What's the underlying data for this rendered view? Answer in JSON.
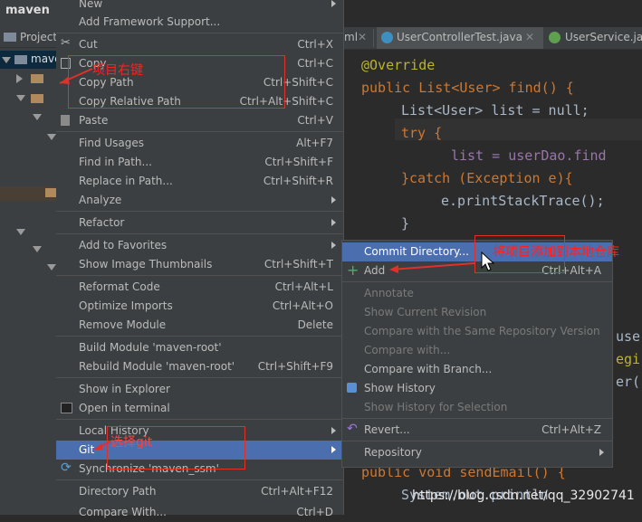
{
  "project_panel": {
    "title": "maven",
    "header_label": "Project",
    "selected_label": "mave"
  },
  "editor": {
    "tabs": [
      {
        "label": "ml",
        "closable": true
      },
      {
        "label": "UserControllerTest.java",
        "closable": true
      },
      {
        "label": "UserService.java",
        "closable": false
      }
    ],
    "code_lines": [
      "@Override",
      "public List<User> find() {",
      "List<User> list = null;",
      "try {",
      "list = userDao.find",
      "}catch (Exception e){",
      "e.printStackTrace();",
      "}",
      "use",
      "egi",
      "er(",
      "public void sendEmail() {",
      "System.out.println"
    ]
  },
  "context_menu": {
    "items": [
      {
        "label": "New",
        "shortcut": "",
        "submenu": true
      },
      {
        "label": "Add Framework Support...",
        "shortcut": ""
      },
      {
        "label": "Cut",
        "shortcut": "Ctrl+X",
        "icon": "scissors-icon"
      },
      {
        "label": "Copy",
        "shortcut": "Ctrl+C",
        "icon": "copy-icon"
      },
      {
        "label": "Copy Path",
        "shortcut": "Ctrl+Shift+C"
      },
      {
        "label": "Copy Relative Path",
        "shortcut": "Ctrl+Alt+Shift+C"
      },
      {
        "label": "Paste",
        "shortcut": "Ctrl+V",
        "icon": "paste-icon"
      },
      {
        "label": "Find Usages",
        "shortcut": "Alt+F7"
      },
      {
        "label": "Find in Path...",
        "shortcut": "Ctrl+Shift+F"
      },
      {
        "label": "Replace in Path...",
        "shortcut": "Ctrl+Shift+R"
      },
      {
        "label": "Analyze",
        "shortcut": "",
        "submenu": true
      },
      {
        "label": "Refactor",
        "shortcut": "",
        "submenu": true
      },
      {
        "label": "Add to Favorites",
        "shortcut": "",
        "submenu": true
      },
      {
        "label": "Show Image Thumbnails",
        "shortcut": "Ctrl+Shift+T"
      },
      {
        "label": "Reformat Code",
        "shortcut": "Ctrl+Alt+L"
      },
      {
        "label": "Optimize Imports",
        "shortcut": "Ctrl+Alt+O"
      },
      {
        "label": "Remove Module",
        "shortcut": "Delete"
      },
      {
        "label": "Build Module 'maven-root'",
        "shortcut": ""
      },
      {
        "label": "Rebuild Module 'maven-root'",
        "shortcut": "Ctrl+Shift+F9"
      },
      {
        "label": "Show in Explorer",
        "shortcut": ""
      },
      {
        "label": "Open in terminal",
        "shortcut": "",
        "icon": "terminal-icon"
      },
      {
        "label": "Local History",
        "shortcut": "",
        "submenu": true
      },
      {
        "label": "Git",
        "shortcut": "",
        "submenu": true,
        "highlighted": true
      },
      {
        "label": "Synchronize 'maven_ssm'",
        "shortcut": "",
        "icon": "sync-icon"
      },
      {
        "label": "Directory Path",
        "shortcut": "Ctrl+Alt+F12"
      },
      {
        "label": "Compare With...",
        "shortcut": "Ctrl+D"
      }
    ]
  },
  "git_submenu": {
    "items": [
      {
        "label": "Commit Directory...",
        "shortcut": "",
        "highlighted": true
      },
      {
        "label": "Add",
        "shortcut": "Ctrl+Alt+A",
        "icon": "plus-icon"
      },
      {
        "label": "Annotate",
        "disabled": true
      },
      {
        "label": "Show Current Revision",
        "disabled": true
      },
      {
        "label": "Compare with the Same Repository Version",
        "disabled": true
      },
      {
        "label": "Compare with...",
        "disabled": true
      },
      {
        "label": "Compare with Branch...",
        "shortcut": ""
      },
      {
        "label": "Show History",
        "shortcut": "",
        "icon": "history-icon"
      },
      {
        "label": "Show History for Selection",
        "disabled": true
      },
      {
        "label": "Revert...",
        "shortcut": "Ctrl+Alt+Z",
        "icon": "revert-icon"
      },
      {
        "label": "Repository",
        "shortcut": "",
        "submenu": true
      }
    ]
  },
  "annotations": {
    "right_click_note": "项目右键",
    "git_note": "选择git",
    "add_note": "将项目添加到本地仓库"
  },
  "watermark": "https://blog.csdn.net/qq_32902741",
  "colors": {
    "highlight": "#4b6eaf",
    "annotation_red": "#e0302a",
    "keyword": "#cc7832",
    "annotation_yellow": "#bbb529"
  }
}
